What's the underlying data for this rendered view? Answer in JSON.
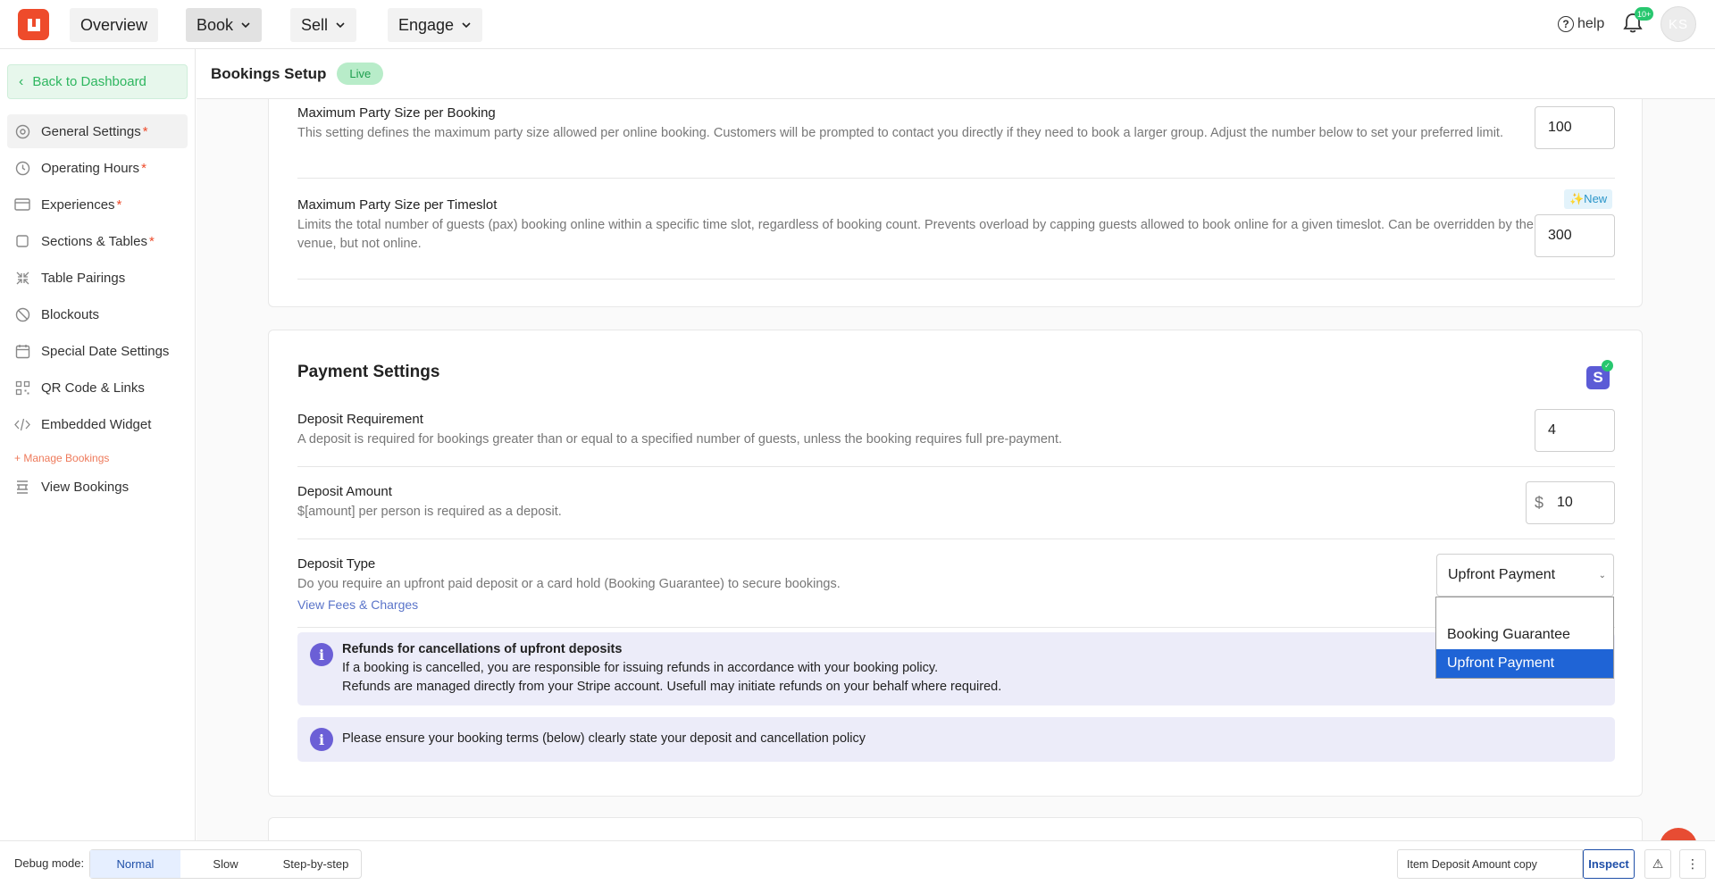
{
  "nav": {
    "items": [
      {
        "label": "Overview",
        "chevron": false
      },
      {
        "label": "Book",
        "chevron": true,
        "active": true
      },
      {
        "label": "Sell",
        "chevron": true
      },
      {
        "label": "Engage",
        "chevron": true
      }
    ],
    "help_label": "help",
    "notification_badge": "10+",
    "avatar_initials": "KS"
  },
  "sidebar": {
    "back_label": "Back to Dashboard",
    "items": [
      {
        "label": "General Settings",
        "required": "*",
        "icon": "gear-icon"
      },
      {
        "label": "Operating Hours",
        "required": "*",
        "icon": "clock-icon"
      },
      {
        "label": "Experiences",
        "required": "*",
        "icon": "card-icon"
      },
      {
        "label": "Sections & Tables",
        "required": "*",
        "icon": "square-icon"
      },
      {
        "label": "Table Pairings",
        "required": "",
        "icon": "pair-icon"
      },
      {
        "label": "Blockouts",
        "required": "",
        "icon": "block-icon"
      },
      {
        "label": "Special Date Settings",
        "required": "",
        "icon": "calendar-icon"
      },
      {
        "label": "QR Code & Links",
        "required": "",
        "icon": "qr-icon"
      },
      {
        "label": "Embedded Widget",
        "required": "",
        "icon": "code-icon"
      }
    ],
    "section_label": "+ Manage Bookings",
    "view_bookings": "View Bookings"
  },
  "header": {
    "title": "Bookings Setup",
    "status": "Live"
  },
  "party_card": {
    "max_booking": {
      "label": "Maximum Party Size per Booking",
      "desc": "This setting defines the maximum party size allowed per online booking. Customers will be prompted to contact you directly if they need to book a larger group. Adjust the number below to set your preferred limit.",
      "value": "100"
    },
    "max_timeslot": {
      "label": "Maximum Party Size per Timeslot",
      "desc": "Limits the total number of guests (pax) booking online within a specific time slot, regardless of booking count. Prevents overload by capping guests allowed to book online for a given timeslot. Can be overridden by the venue, but not online.",
      "value": "300",
      "badge": "✨New"
    }
  },
  "payment": {
    "title": "Payment Settings",
    "stripe_glyph": "S",
    "deposit_req": {
      "label": "Deposit Requirement",
      "desc": "A deposit is required for bookings greater than or equal to a specified number of guests, unless the booking requires full pre-payment.",
      "value": "4"
    },
    "deposit_amount": {
      "label": "Deposit Amount",
      "desc": "$[amount] per person is required as a deposit.",
      "currency": "$",
      "value": "10"
    },
    "deposit_type": {
      "label": "Deposit Type",
      "desc": "Do you require an upfront paid deposit or a card hold (Booking Guarantee) to secure bookings.",
      "link": "View Fees & Charges",
      "value": "Upfront Payment",
      "options": [
        "",
        "Booking Guarantee",
        "Upfront Payment"
      ]
    },
    "refund_info": {
      "title": "Refunds for cancellations of upfront deposits",
      "line1": "If a booking is cancelled, you are responsible for issuing refunds in accordance with your booking policy.",
      "line2": "Refunds are managed directly from your Stripe account. Usefull may initiate refunds on your behalf where required."
    },
    "terms_info": "Please ensure your booking terms (below) clearly state your deposit and cancellation policy"
  },
  "debug": {
    "label": "Debug mode:",
    "modes": [
      "Normal",
      "Slow",
      "Step-by-step"
    ],
    "active_mode": "Normal",
    "field": "Item Deposit Amount copy",
    "inspect": "Inspect"
  },
  "colors": {
    "brand": "#ee4b2b",
    "success": "#2eb65f",
    "accent": "#6b5fd6",
    "selection": "#1f64d6"
  }
}
